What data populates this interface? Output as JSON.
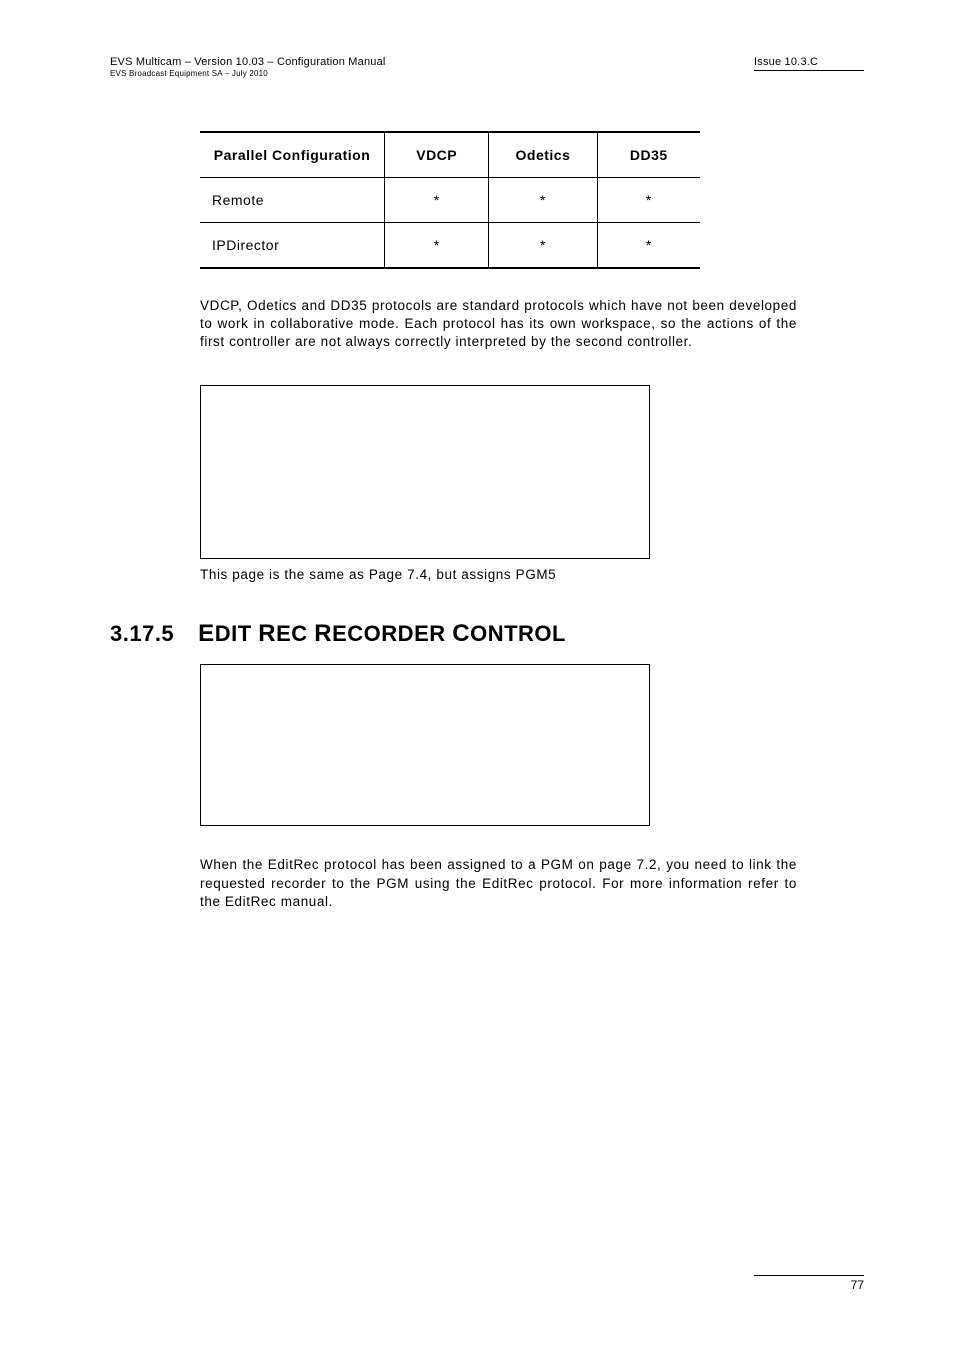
{
  "header": {
    "left_line1": "EVS Multicam – Version 10.03 – Configuration Manual",
    "left_line2": "EVS Broadcast Equipment SA – July  2010",
    "right": "Issue 10.3.C"
  },
  "table": {
    "columns": [
      "Parallel Configuration",
      "VDCP",
      "Odetics",
      "DD35"
    ],
    "rows": [
      {
        "label": "Remote",
        "cells": [
          "*",
          "*",
          "*"
        ]
      },
      {
        "label": "IPDirector",
        "cells": [
          "*",
          "*",
          "*"
        ]
      }
    ]
  },
  "paragraph1": "VDCP, Odetics and DD35 protocols are standard protocols which have not been developed to work in collaborative mode. Each protocol has its own workspace, so the actions of the first controller are not always correctly interpreted by the second controller.",
  "caption1": "This page is the same as Page 7.4, but assigns PGM5",
  "section": {
    "number": "3.17.5",
    "title_parts": [
      "E",
      "DIT ",
      "R",
      "EC ",
      "R",
      "ECORDER ",
      "C",
      "ONTROL"
    ]
  },
  "paragraph2": "When the EditRec protocol has been assigned to a PGM on page 7.2, you need to link the requested recorder to the PGM using the EditRec protocol. For more information refer to the EditRec manual.",
  "footer": {
    "pagenum": "77"
  }
}
